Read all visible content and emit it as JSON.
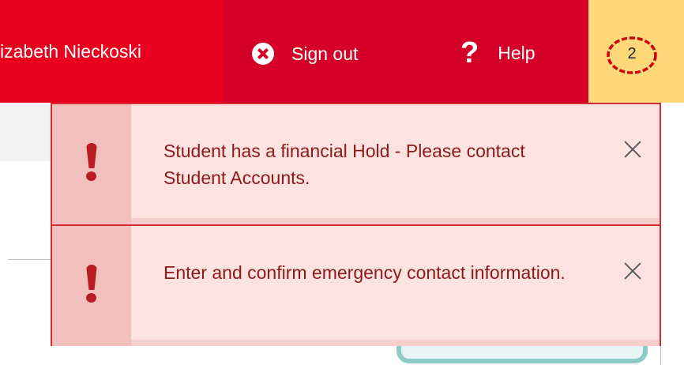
{
  "header": {
    "user_name": "izabeth Nieckoski",
    "signout_label": "Sign out",
    "signout_icon": "x-circle-icon",
    "help_label": "Help",
    "help_icon": "question-mark-icon",
    "notification_count": "2",
    "colors": {
      "user_bg": "#e9001f",
      "signout_bg": "#d50027",
      "notification_bg": "#ffd87a",
      "annotation_circle": "#d00000"
    }
  },
  "alerts": [
    {
      "icon": "exclamation-icon",
      "text": "Student has a financial Hold - Please contact Student Accounts.",
      "close_icon": "close-icon"
    },
    {
      "icon": "exclamation-icon",
      "text": "Enter and confirm emergency contact information.",
      "close_icon": "close-icon"
    }
  ],
  "alert_colors": {
    "background": "#fce3e0",
    "side": "#f2c0bc",
    "border": "#d62a35",
    "text": "#8c1a18"
  }
}
